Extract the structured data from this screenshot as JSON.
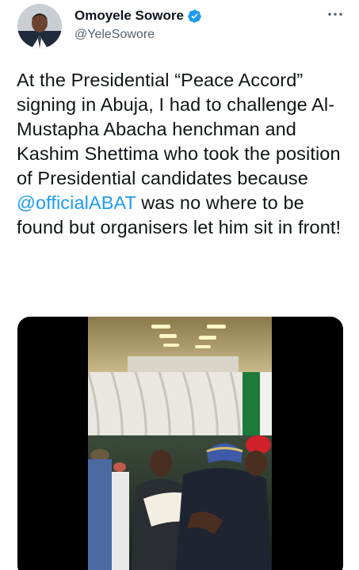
{
  "user": {
    "display_name": "Omoyele Sowore",
    "handle": "@YeleSowore",
    "verified": true,
    "avatar_icon": "profile-photo"
  },
  "tweet": {
    "text_before": "At the Presidential “Peace Accord” signing in Abuja, I had to challenge Al-Mustapha Abacha henchman and Kashim Shettima who took the position of Presidential candidates because ",
    "mention": "@officialABAT",
    "text_after": " was no where to be found but organisers let him sit in front!"
  },
  "media": {
    "type": "video",
    "description_icon": "video-thumbnail"
  },
  "colors": {
    "accent": "#1d9bf0",
    "text": "#0f1419",
    "secondary": "#536471"
  }
}
